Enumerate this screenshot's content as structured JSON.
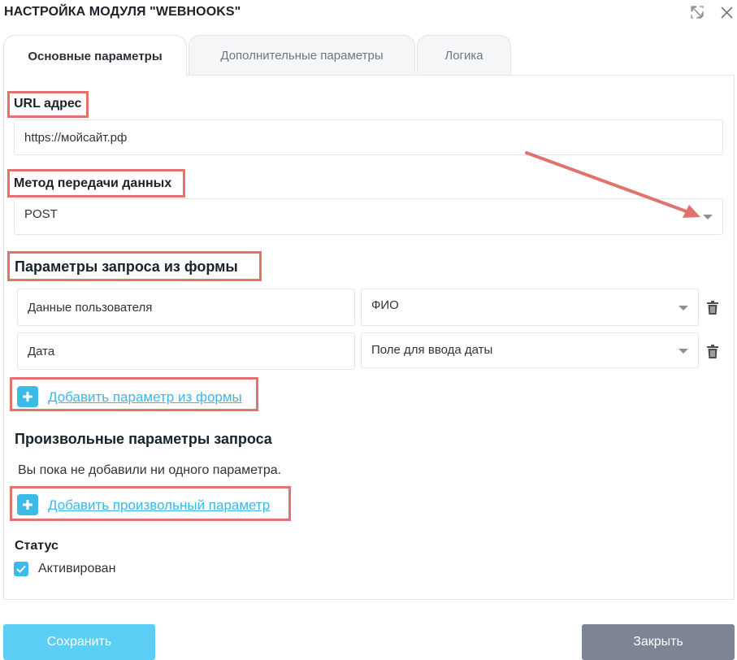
{
  "window": {
    "title": "НАСТРОЙКА МОДУЛЯ \"WEBHOOKS\""
  },
  "tabs": [
    {
      "label": "Основные параметры",
      "active": true
    },
    {
      "label": "Дополнительные параметры",
      "active": false
    },
    {
      "label": "Логика",
      "active": false
    }
  ],
  "url_section": {
    "label": "URL адрес",
    "value": "https://мойсайт.рф"
  },
  "method_section": {
    "label": "Метод передачи данных",
    "value": "POST"
  },
  "form_params": {
    "heading": "Параметры запроса из формы",
    "rows": [
      {
        "name": "Данные пользователя",
        "field": "ФИО"
      },
      {
        "name": "Дата",
        "field": "Поле для ввода даты"
      }
    ],
    "add_label": "Добавить параметр из формы"
  },
  "custom_params": {
    "heading": "Произвольные параметры запроса",
    "empty_text": "Вы пока не добавили ни одного параметра.",
    "add_label": "Добавить произвольный параметр"
  },
  "status": {
    "heading": "Статус",
    "checkbox_label": "Активирован",
    "checked": true
  },
  "footer": {
    "save_label": "Сохранить",
    "close_label": "Закрыть"
  },
  "colors": {
    "accent": "#3bbbe8",
    "highlight": "#e2726d",
    "save_button": "#5ccdf4",
    "close_button": "#7d8594"
  },
  "icons": [
    "expand-icon",
    "close-icon",
    "chevron-down-icon",
    "trash-icon",
    "plus-icon",
    "checkmark-icon"
  ]
}
